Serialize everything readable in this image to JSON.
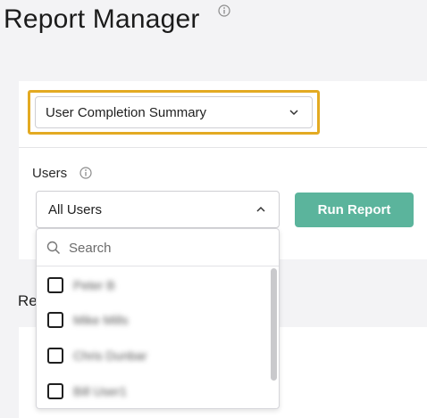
{
  "page": {
    "title": "Report Manager"
  },
  "report_select": {
    "value": "User Completion Summary"
  },
  "users": {
    "label": "Users",
    "selected": "All Users",
    "search_placeholder": "Search",
    "options": [
      "Peter B",
      "Mike Mills",
      "Chris Dunbar",
      "Bill User1"
    ]
  },
  "run_button": {
    "label": "Run Report"
  },
  "section_header": {
    "text": "Re"
  },
  "colors": {
    "accent": "#5bb49c",
    "focus_border": "#e3aa22",
    "background": "#f3f3f5"
  }
}
